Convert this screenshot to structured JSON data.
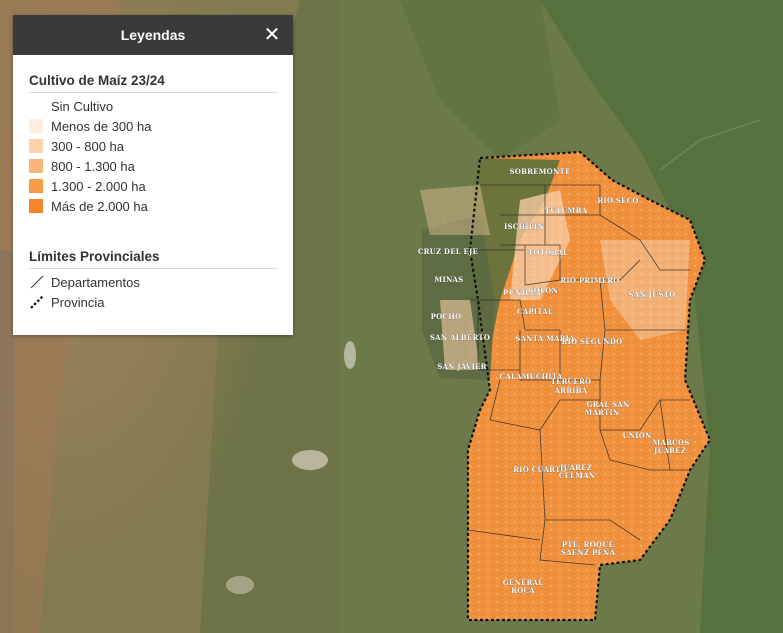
{
  "legend": {
    "title": "Leyendas",
    "close_icon": "close-icon",
    "crop_section": {
      "title": "Cultivo de Maíz 23/24",
      "items": [
        {
          "label": "Sin Cultivo",
          "color": "#ffffff"
        },
        {
          "label": "Menos de 300 ha",
          "color": "#fdeede"
        },
        {
          "label": "300 - 800 ha",
          "color": "#fcd3ae"
        },
        {
          "label": "800 - 1.300 ha",
          "color": "#f9b57a"
        },
        {
          "label": "1.300 - 2.000 ha",
          "color": "#f89c4c"
        },
        {
          "label": "Más de 2.000 ha",
          "color": "#f3852d"
        }
      ]
    },
    "limits_section": {
      "title": "Límites Provinciales",
      "items": [
        {
          "label": "Departamentos",
          "icon": "thin-line-icon"
        },
        {
          "label": "Provincia",
          "icon": "dashed-line-icon"
        }
      ]
    }
  },
  "map": {
    "departments": [
      "SOBREMONTE",
      "RIO SECO",
      "TULUMBA",
      "ISCHILIN",
      "CRUZ DEL EJE",
      "TOTORAL",
      "RIO PRIMERO",
      "SAN JUSTO",
      "MINAS",
      "PUNILLA",
      "COLON",
      "POCHO",
      "CAPITAL",
      "SAN ALBERTO",
      "SANTA MARIA",
      "RIO SEGUNDO",
      "SAN JAVIER",
      "CALAMUCHITA",
      "TERCERO ARRIBA",
      "GRAL SAN MARTIN",
      "UNION",
      "MARCOS JUAREZ",
      "RIO CUARTO",
      "JUAREZ CELMAN",
      "PTE. ROQUE SAENZ PEÑA",
      "GENERAL ROCA"
    ]
  }
}
